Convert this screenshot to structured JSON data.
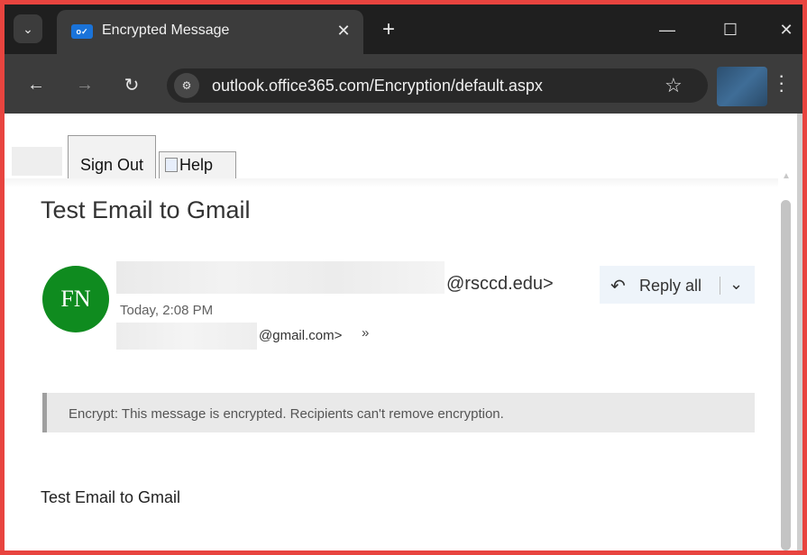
{
  "browser": {
    "tab_search_icon": "chevron-down-icon",
    "tab": {
      "title": "Encrypted Message",
      "favicon_text": "o✓"
    },
    "new_tab_label": "+",
    "window_controls": {
      "minimize": "—",
      "maximize": "☐",
      "close": "✕"
    },
    "url": "outlook.office365.com/Encryption/default.aspx"
  },
  "page": {
    "signout_label": "Sign Out",
    "help_label": "Help",
    "subject": "Test Email to Gmail",
    "avatar_initials": "FN",
    "sender_domain": "@rsccd.edu>",
    "date": "Today, 2:08 PM",
    "recipient_domain": "@gmail.com>",
    "reply_all_label": "Reply all",
    "encryption_notice": "Encrypt: This message is encrypted. Recipients can't remove encryption.",
    "body": "Test Email to Gmail"
  },
  "colors": {
    "outer_border": "#e8443f",
    "avatar": "#0f8b1f",
    "reply_button_bg": "#eef4fa",
    "notice_bg": "#e9e9e9"
  }
}
